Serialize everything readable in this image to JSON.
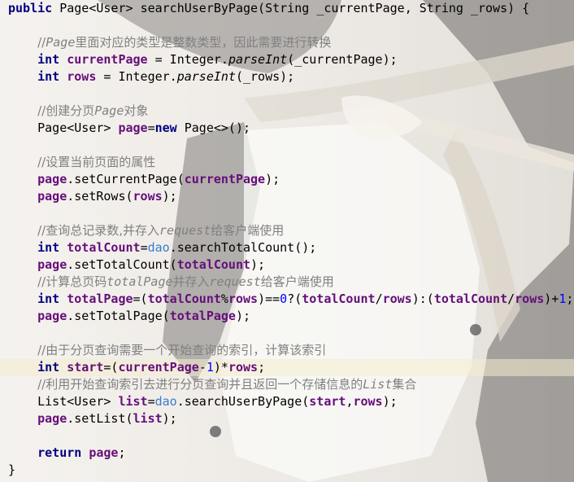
{
  "code": {
    "l01": {
      "kw_public": "public",
      "ret_type": "Page<User>",
      "method_name": "searchUserByPage(",
      "p1_type": "String",
      "p1_name": "_currentPage",
      "sep": ", ",
      "p2_type": "String",
      "p2_name": "_rows",
      "tail": ") {"
    },
    "l03": {
      "c1": "//",
      "c2": "Page",
      "c3": "里面对应的类型是整数类型，因此需要进行转换"
    },
    "l04": {
      "kw": "int",
      "var": "currentPage",
      "mid": " = Integer.",
      "method": "parseInt",
      "arg": "(_currentPage);"
    },
    "l05": {
      "kw": "int",
      "var": "rows",
      "mid": " = Integer.",
      "method": "parseInt",
      "arg": "(_rows);"
    },
    "l07": {
      "c1": "//创建分页",
      "c2": "Page",
      "c3": "对象"
    },
    "l08": {
      "type": "Page<User>",
      "var": "page",
      "eq": "=",
      "kw": "new",
      "tail": " Page<>();"
    },
    "l10": {
      "c1": "//设置当前页面的属性"
    },
    "l11": {
      "var": "page",
      "call": ".setCurrentPage(",
      "arg": "currentPage",
      "tail": ");"
    },
    "l12": {
      "var": "page",
      "call": ".setRows(",
      "arg": "rows",
      "tail": ");"
    },
    "l14": {
      "c1": "//查询总记录数,并存入",
      "c2": "request",
      "c3": "给客户端使用"
    },
    "l15": {
      "kw": "int",
      "var": "totalCount",
      "eq": "=",
      "field": "dao",
      "tail": ".searchTotalCount();"
    },
    "l16": {
      "var": "page",
      "call": ".setTotalCount(",
      "arg": "totalCount",
      "tail": ");"
    },
    "l17": {
      "c1": "//计算总页码",
      "c2": "totalPage",
      "c3": "并存入",
      "c4": "request",
      "c5": "给客户端使用"
    },
    "l18": {
      "kw": "int",
      "var": "totalPage",
      "t1": "=(",
      "v1": "totalCount",
      "t2": "%",
      "v2": "rows",
      "t3": ")==",
      "n0": "0",
      "t4": "?(",
      "v3": "totalCount",
      "t5": "/",
      "v4": "rows",
      "t6": "):(",
      "v5": "totalCount",
      "t7": "/",
      "v6": "rows",
      "t8": ")+",
      "n1": "1",
      "t9": ";"
    },
    "l19": {
      "var": "page",
      "call": ".setTotalPage(",
      "arg": "totalPage",
      "tail": ");"
    },
    "l21": {
      "c1": "//由于分页查询需要一个开始查询的索引，计算该索引"
    },
    "l22": {
      "kw": "int",
      "var": "start",
      "t1": "=(",
      "v1": "currentPage",
      "t2": "-",
      "n1": "1",
      "t3": ")*",
      "v2": "rows",
      "t4": ";"
    },
    "l23": {
      "c1": "//利用开始查询索引去进行分页查询并且返回一个存储信息的",
      "c2": "List",
      "c3": "集合"
    },
    "l24": {
      "type": "List<User>",
      "var": "list",
      "eq": "=",
      "field": "dao",
      "call": ".searchUserByPage(",
      "a1": "start",
      "comma": ",",
      "a2": "rows",
      "tail": ");"
    },
    "l25": {
      "var": "page",
      "call": ".setList(",
      "arg": "list",
      "tail": ");"
    },
    "l27": {
      "kw": "return",
      "var": "page",
      "tail": ";"
    },
    "l28": {
      "brace": "}"
    }
  },
  "colors": {
    "keyword": "#000080",
    "local_variable": "#660e7a",
    "field": "#3a7bd0",
    "number": "#0000ff",
    "comment": "#808080",
    "current_line": "#f2eccd"
  }
}
